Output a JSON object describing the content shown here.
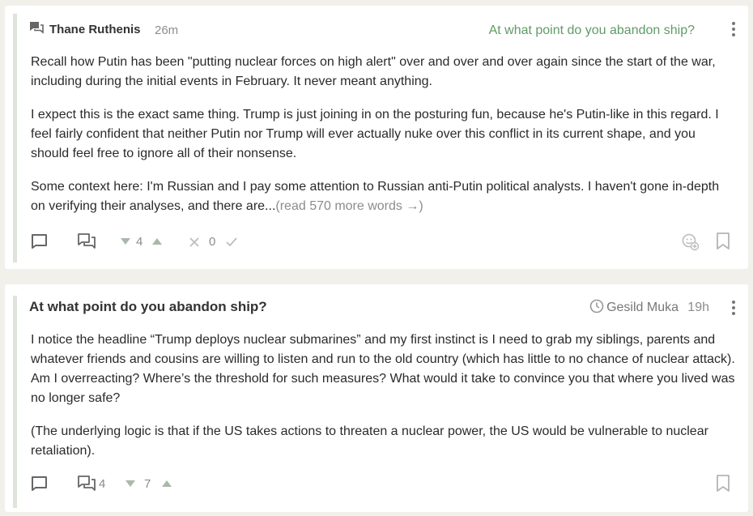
{
  "comment": {
    "author": "Thane Ruthenis",
    "age": "26m",
    "post_link": "At what point do you abandon ship?",
    "paragraphs": [
      "Recall how Putin has been \"putting nuclear forces on high alert\" over and over and over again since the start of the war, including during the initial events in February. It never meant anything.",
      "I expect this is the exact same thing. Trump is just joining in on the posturing fun, because he's Putin-like in this regard. I feel fairly confident that neither Putin nor Trump will ever actually nuke over this conflict in its current shape, and you should feel free to ignore all of their nonsense.",
      "Some context here: I'm Russian and I pay some attention to Russian anti-Putin political analysts. I haven't gone in-depth on verifying their analyses, and there are..."
    ],
    "read_more": "(read 570 more words →)",
    "karma": "4",
    "agreement": "0",
    "icons": [
      "comment-icon",
      "reply-icon",
      "thread-icon",
      "vote-down-icon",
      "vote-up-icon",
      "disagree-icon",
      "agree-icon",
      "react-icon",
      "bookmark-icon",
      "more-icon"
    ]
  },
  "post": {
    "title": "At what point do you abandon ship?",
    "author": "Gesild Muka",
    "age": "19h",
    "paragraphs": [
      "I notice the headline “Trump deploys nuclear submarines” and my first instinct is I need to grab my siblings, parents and whatever friends and cousins are willing to listen and run to the old country (which has little to no chance of nuclear attack). Am I overreacting? Where’s the threshold for such measures? What would it take to convince you that where you lived was no longer safe?",
      "(The underlying logic is that if the US takes actions to threaten a nuclear power, the US would be vulnerable to nuclear retaliation)."
    ],
    "comment_count": "4",
    "karma": "7",
    "icons": [
      "clock-icon",
      "more-icon",
      "reply-icon",
      "comments-icon",
      "vote-down-icon",
      "vote-up-icon",
      "bookmark-icon"
    ]
  },
  "colors": {
    "background": "#f2f0ea",
    "card": "#ffffff",
    "accent_green": "#5f9b65",
    "left_bar": "#dde4d9",
    "muted": "#8c8c8c"
  }
}
